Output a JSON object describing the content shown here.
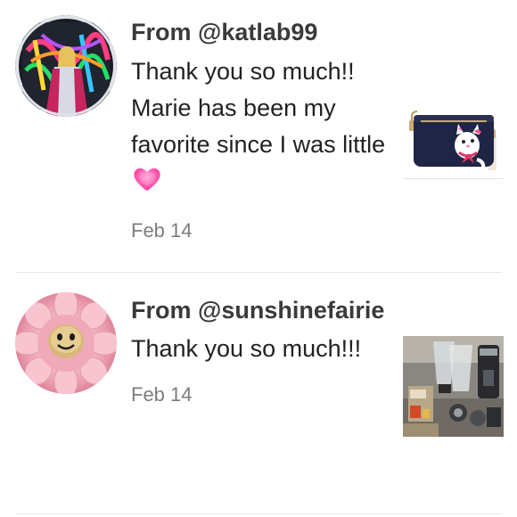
{
  "notifications": [
    {
      "from_label": "From @katlab99",
      "message": "Thank you so much!! Marie has been my favorite since I was little",
      "emoji_icon": "pink-heart-icon",
      "date": "Feb 14",
      "avatar_icon": "user-avatar-neon",
      "thumbnail_icon": "product-thumbnail-bag"
    },
    {
      "from_label": "From @sunshinefairie",
      "message": "Thank you so much!!!",
      "date": "Feb 14",
      "avatar_icon": "user-avatar-flower",
      "thumbnail_icon": "product-thumbnail-blender"
    }
  ],
  "colors": {
    "heart_pink": "#ff3fa4",
    "date_gray": "#7d7d7d",
    "divider": "#e6e6e6"
  }
}
